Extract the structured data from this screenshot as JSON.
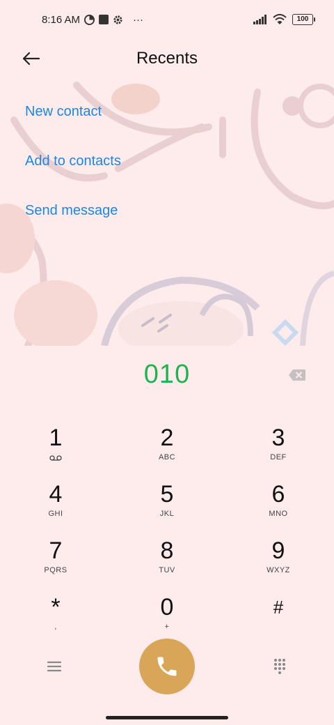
{
  "status_bar": {
    "time": "8:16 AM",
    "more": "···",
    "battery": "100",
    "icons": [
      "data-saver-icon",
      "square-app-icon",
      "gear-icon",
      "signal-icon",
      "wifi-icon",
      "battery-icon"
    ]
  },
  "header": {
    "title": "Recents"
  },
  "actions": [
    {
      "label": "New contact"
    },
    {
      "label": "Add to contacts"
    },
    {
      "label": "Send message"
    }
  ],
  "dialpad": {
    "number": "010",
    "keys": [
      {
        "digit": "1",
        "letters": ""
      },
      {
        "digit": "2",
        "letters": "ABC"
      },
      {
        "digit": "3",
        "letters": "DEF"
      },
      {
        "digit": "4",
        "letters": "GHI"
      },
      {
        "digit": "5",
        "letters": "JKL"
      },
      {
        "digit": "6",
        "letters": "MNO"
      },
      {
        "digit": "7",
        "letters": "PQRS"
      },
      {
        "digit": "8",
        "letters": "TUV"
      },
      {
        "digit": "9",
        "letters": "WXYZ"
      },
      {
        "digit": "*",
        "letters": ","
      },
      {
        "digit": "0",
        "letters": "+"
      },
      {
        "digit": "#",
        "letters": ""
      }
    ]
  },
  "colors": {
    "background": "#fdeceb",
    "link": "#1d86e3",
    "number": "#1fb24f",
    "call_button": "#d9a559"
  }
}
